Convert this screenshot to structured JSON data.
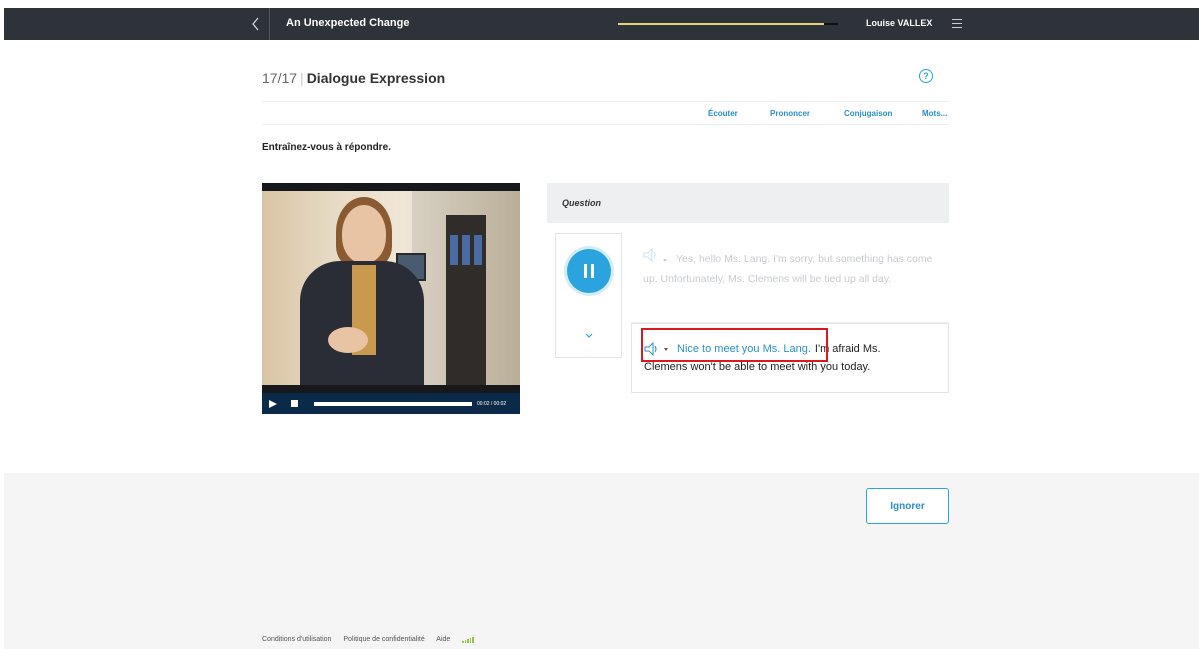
{
  "topbar": {
    "title": "An Unexpected Change",
    "user": "Louise VALLEX",
    "progress_color": "#e6d27a"
  },
  "header": {
    "counter": "17/17",
    "separator": "|",
    "title": "Dialogue Expression"
  },
  "tools": [
    "Écouter",
    "Prononcer",
    "Conjugaison",
    "Mots..."
  ],
  "instruction": "Entraînez-vous à répondre.",
  "video": {
    "time": "00:02 / 00:02",
    "progress": 1.0
  },
  "question": {
    "label": "Question",
    "message1": "Yes, hello Ms. Lang. I'm sorry, but something has come up. Unfortunately, Ms. Clemens will be tied up all day.",
    "message2_answer": "Nice to meet you Ms. Lang.",
    "message2_rest_line1": "I'm afraid Ms.",
    "message2_rest_line2": "Clemens won't be able to meet with you today."
  },
  "footer": {
    "ignore_label": "Ignorer",
    "links": [
      "Conditions d'utilisation",
      "Politique de confidentialité",
      "Aide"
    ]
  },
  "colors": {
    "accent": "#2aa3df",
    "topbar": "#2d3338",
    "highlight": "#d9181f"
  }
}
